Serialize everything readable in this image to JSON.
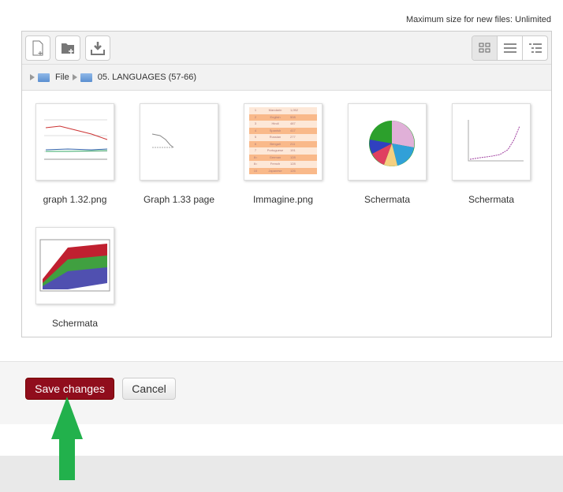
{
  "max_size": "Maximum size for new files: Unlimited",
  "toolbar": {
    "buttons": [
      "file-add-icon",
      "folder-add-icon",
      "download-icon"
    ],
    "views": [
      "grid-icon",
      "list-icon",
      "tree-icon"
    ]
  },
  "breadcrumb": [
    "File",
    "05. LANGUAGES (57-66)"
  ],
  "files": [
    {
      "name": "graph 1.32.png"
    },
    {
      "name": "Graph 1.33 page"
    },
    {
      "name": "Immagine.png"
    },
    {
      "name": "Schermata"
    },
    {
      "name": "Schermata"
    },
    {
      "name": "Schermata"
    }
  ],
  "table_thumb": {
    "rows": [
      [
        "1",
        "Mandarin",
        "1,052"
      ],
      [
        "2",
        "English",
        "508"
      ],
      [
        "3",
        "Hindi",
        "487"
      ],
      [
        "4",
        "Spanish",
        "417"
      ],
      [
        "5",
        "Russian",
        "277"
      ],
      [
        "6",
        "Bengali",
        "211"
      ],
      [
        "7",
        "Portuguese",
        "191"
      ],
      [
        "8=",
        "German",
        "128"
      ],
      [
        "8=",
        "French",
        "128"
      ],
      [
        "10",
        "Japanese",
        "126"
      ]
    ]
  },
  "buttons": {
    "save": "Save changes",
    "cancel": "Cancel"
  },
  "colors": {
    "save": "#900d1c",
    "arrow": "#22b14c"
  }
}
